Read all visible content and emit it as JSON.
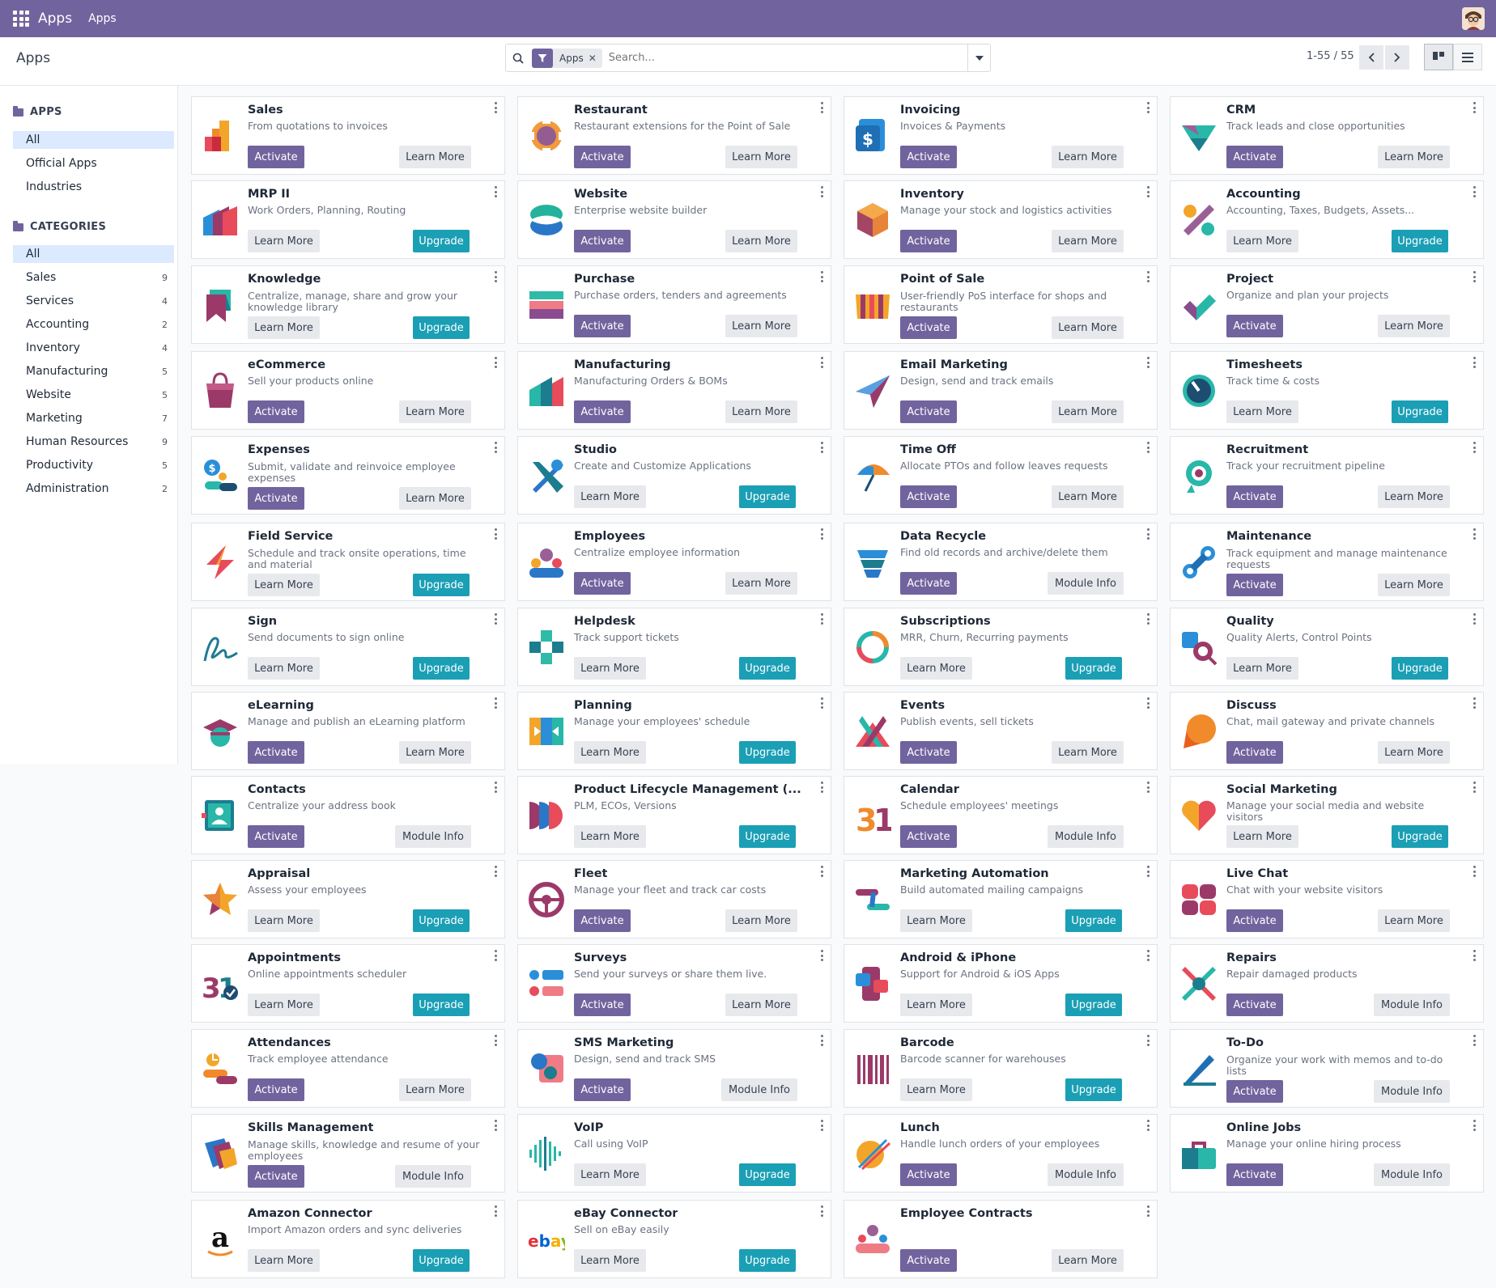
{
  "navbar": {
    "app_name": "Apps",
    "menu_item": "Apps"
  },
  "control_panel": {
    "breadcrumb": "Apps",
    "facet_value": "Apps",
    "search_placeholder": "Search...",
    "pager": "1-55 / 55"
  },
  "sidebar": {
    "apps_heading": "APPS",
    "apps_items": [
      {
        "label": "All",
        "active": true
      },
      {
        "label": "Official Apps"
      },
      {
        "label": "Industries"
      }
    ],
    "categories_heading": "CATEGORIES",
    "category_items": [
      {
        "label": "All",
        "active": true,
        "count": ""
      },
      {
        "label": "Sales",
        "count": "9"
      },
      {
        "label": "Services",
        "count": "4"
      },
      {
        "label": "Accounting",
        "count": "2"
      },
      {
        "label": "Inventory",
        "count": "4"
      },
      {
        "label": "Manufacturing",
        "count": "5"
      },
      {
        "label": "Website",
        "count": "5"
      },
      {
        "label": "Marketing",
        "count": "7"
      },
      {
        "label": "Human Resources",
        "count": "9"
      },
      {
        "label": "Productivity",
        "count": "5"
      },
      {
        "label": "Administration",
        "count": "2"
      }
    ]
  },
  "button_labels": {
    "activate": "Activate",
    "learn": "Learn More",
    "upgrade": "Upgrade",
    "info": "Module Info"
  },
  "apps": [
    {
      "name": "Sales",
      "desc": "From quotations to invoices",
      "buttons": "activate-learn",
      "icon": "sales-icon"
    },
    {
      "name": "Restaurant",
      "desc": "Restaurant extensions for the Point of Sale",
      "buttons": "activate-learn",
      "icon": "restaurant-icon"
    },
    {
      "name": "Invoicing",
      "desc": "Invoices & Payments",
      "buttons": "activate-learn",
      "icon": "invoicing-icon"
    },
    {
      "name": "CRM",
      "desc": "Track leads and close opportunities",
      "buttons": "activate-learn",
      "icon": "crm-icon"
    },
    {
      "name": "MRP II",
      "desc": "Work Orders, Planning, Routing",
      "buttons": "learn-upgrade",
      "icon": "mrp-icon"
    },
    {
      "name": "Website",
      "desc": "Enterprise website builder",
      "buttons": "activate-learn",
      "icon": "website-icon"
    },
    {
      "name": "Inventory",
      "desc": "Manage your stock and logistics activities",
      "buttons": "activate-learn",
      "icon": "inventory-icon"
    },
    {
      "name": "Accounting",
      "desc": "Accounting, Taxes, Budgets, Assets...",
      "buttons": "learn-upgrade",
      "icon": "accounting-icon"
    },
    {
      "name": "Knowledge",
      "desc": "Centralize, manage, share and grow your knowledge library",
      "buttons": "learn-upgrade",
      "icon": "knowledge-icon"
    },
    {
      "name": "Purchase",
      "desc": "Purchase orders, tenders and agreements",
      "buttons": "activate-learn",
      "icon": "purchase-icon"
    },
    {
      "name": "Point of Sale",
      "desc": "User-friendly PoS interface for shops and restaurants",
      "buttons": "activate-learn",
      "icon": "point-of-sale-icon"
    },
    {
      "name": "Project",
      "desc": "Organize and plan your projects",
      "buttons": "activate-learn",
      "icon": "project-icon"
    },
    {
      "name": "eCommerce",
      "desc": "Sell your products online",
      "buttons": "activate-learn",
      "icon": "ecommerce-icon"
    },
    {
      "name": "Manufacturing",
      "desc": "Manufacturing Orders & BOMs",
      "buttons": "activate-learn",
      "icon": "manufacturing-icon"
    },
    {
      "name": "Email Marketing",
      "desc": "Design, send and track emails",
      "buttons": "activate-learn",
      "icon": "email-marketing-icon"
    },
    {
      "name": "Timesheets",
      "desc": "Track time & costs",
      "buttons": "learn-upgrade",
      "icon": "timesheets-icon"
    },
    {
      "name": "Expenses",
      "desc": "Submit, validate and reinvoice employee expenses",
      "buttons": "activate-learn",
      "icon": "expenses-icon"
    },
    {
      "name": "Studio",
      "desc": "Create and Customize Applications",
      "buttons": "learn-upgrade",
      "icon": "studio-icon"
    },
    {
      "name": "Time Off",
      "desc": "Allocate PTOs and follow leaves requests",
      "buttons": "activate-learn",
      "icon": "time-off-icon"
    },
    {
      "name": "Recruitment",
      "desc": "Track your recruitment pipeline",
      "buttons": "activate-learn",
      "icon": "recruitment-icon"
    },
    {
      "name": "Field Service",
      "desc": "Schedule and track onsite operations, time and material",
      "buttons": "learn-upgrade",
      "icon": "field-service-icon"
    },
    {
      "name": "Employees",
      "desc": "Centralize employee information",
      "buttons": "activate-learn",
      "icon": "employees-icon"
    },
    {
      "name": "Data Recycle",
      "desc": "Find old records and archive/delete them",
      "buttons": "activate-info",
      "icon": "data-recycle-icon"
    },
    {
      "name": "Maintenance",
      "desc": "Track equipment and manage maintenance requests",
      "buttons": "activate-learn",
      "icon": "maintenance-icon"
    },
    {
      "name": "Sign",
      "desc": "Send documents to sign online",
      "buttons": "learn-upgrade",
      "icon": "sign-icon"
    },
    {
      "name": "Helpdesk",
      "desc": "Track support tickets",
      "buttons": "learn-upgrade",
      "icon": "helpdesk-icon"
    },
    {
      "name": "Subscriptions",
      "desc": "MRR, Churn, Recurring payments",
      "buttons": "learn-upgrade",
      "icon": "subscriptions-icon"
    },
    {
      "name": "Quality",
      "desc": "Quality Alerts, Control Points",
      "buttons": "learn-upgrade",
      "icon": "quality-icon"
    },
    {
      "name": "eLearning",
      "desc": "Manage and publish an eLearning platform",
      "buttons": "activate-learn",
      "icon": "elearning-icon"
    },
    {
      "name": "Planning",
      "desc": "Manage your employees' schedule",
      "buttons": "learn-upgrade",
      "icon": "planning-icon"
    },
    {
      "name": "Events",
      "desc": "Publish events, sell tickets",
      "buttons": "activate-learn",
      "icon": "events-icon"
    },
    {
      "name": "Discuss",
      "desc": "Chat, mail gateway and private channels",
      "buttons": "activate-learn",
      "icon": "discuss-icon"
    },
    {
      "name": "Contacts",
      "desc": "Centralize your address book",
      "buttons": "activate-info",
      "icon": "contacts-icon"
    },
    {
      "name": "Product Lifecycle Management (...",
      "desc": "PLM, ECOs, Versions",
      "buttons": "learn-upgrade",
      "icon": "plm-icon"
    },
    {
      "name": "Calendar",
      "desc": "Schedule employees' meetings",
      "buttons": "activate-info",
      "icon": "calendar-icon"
    },
    {
      "name": "Social Marketing",
      "desc": "Manage your social media and website visitors",
      "buttons": "learn-upgrade",
      "icon": "social-marketing-icon"
    },
    {
      "name": "Appraisal",
      "desc": "Assess your employees",
      "buttons": "learn-upgrade",
      "icon": "appraisal-icon"
    },
    {
      "name": "Fleet",
      "desc": "Manage your fleet and track car costs",
      "buttons": "activate-learn",
      "icon": "fleet-icon"
    },
    {
      "name": "Marketing Automation",
      "desc": "Build automated mailing campaigns",
      "buttons": "learn-upgrade",
      "icon": "marketing-automation-icon"
    },
    {
      "name": "Live Chat",
      "desc": "Chat with your website visitors",
      "buttons": "activate-learn",
      "icon": "live-chat-icon"
    },
    {
      "name": "Appointments",
      "desc": "Online appointments scheduler",
      "buttons": "learn-upgrade",
      "icon": "appointments-icon"
    },
    {
      "name": "Surveys",
      "desc": "Send your surveys or share them live.",
      "buttons": "activate-learn",
      "icon": "surveys-icon"
    },
    {
      "name": "Android & iPhone",
      "desc": "Support for Android & iOS Apps",
      "buttons": "learn-upgrade",
      "icon": "android-iphone-icon"
    },
    {
      "name": "Repairs",
      "desc": "Repair damaged products",
      "buttons": "activate-info",
      "icon": "repairs-icon"
    },
    {
      "name": "Attendances",
      "desc": "Track employee attendance",
      "buttons": "activate-learn",
      "icon": "attendances-icon"
    },
    {
      "name": "SMS Marketing",
      "desc": "Design, send and track SMS",
      "buttons": "activate-info",
      "icon": "sms-marketing-icon"
    },
    {
      "name": "Barcode",
      "desc": "Barcode scanner for warehouses",
      "buttons": "learn-upgrade",
      "icon": "barcode-icon"
    },
    {
      "name": "To-Do",
      "desc": "Organize your work with memos and to-do lists",
      "buttons": "activate-info",
      "icon": "todo-icon"
    },
    {
      "name": "Skills Management",
      "desc": "Manage skills, knowledge and resume of your employees",
      "buttons": "activate-info",
      "icon": "skills-icon"
    },
    {
      "name": "VoIP",
      "desc": "Call using VoIP",
      "buttons": "learn-upgrade",
      "icon": "voip-icon"
    },
    {
      "name": "Lunch",
      "desc": "Handle lunch orders of your employees",
      "buttons": "activate-info",
      "icon": "lunch-icon"
    },
    {
      "name": "Online Jobs",
      "desc": "Manage your online hiring process",
      "buttons": "activate-info",
      "icon": "online-jobs-icon"
    },
    {
      "name": "Amazon Connector",
      "desc": "Import Amazon orders and sync deliveries",
      "buttons": "learn-upgrade",
      "icon": "amazon-icon"
    },
    {
      "name": "eBay Connector",
      "desc": "Sell on eBay easily",
      "buttons": "learn-upgrade",
      "icon": "ebay-icon"
    },
    {
      "name": "Employee Contracts",
      "desc": "",
      "buttons": "activate-learn",
      "icon": "employee-contracts-icon"
    }
  ]
}
